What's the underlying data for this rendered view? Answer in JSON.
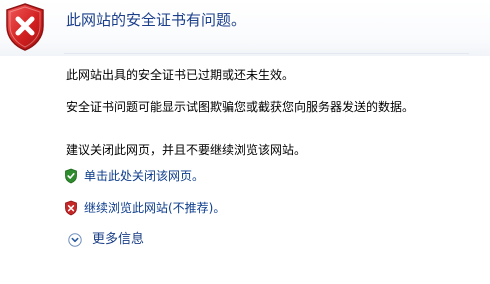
{
  "header": {
    "title": "此网站的安全证书有问题。",
    "icon": "red-shield-x-icon"
  },
  "body": {
    "line1": "此网站出具的安全证书已过期或还未生效。",
    "line2": "安全证书问题可能显示试图欺骗您或截获您向服务器发送的数据。",
    "line3": "建议关闭此网页，并且不要继续浏览该网站。"
  },
  "links": {
    "close_page": "单击此处关闭该网页。",
    "continue_site": "继续浏览此网站(不推荐)。",
    "more_info": "更多信息"
  },
  "colors": {
    "title": "#1b3f8a",
    "link": "#0c3c8c",
    "red": "#c62828",
    "green": "#2e8b2e"
  }
}
